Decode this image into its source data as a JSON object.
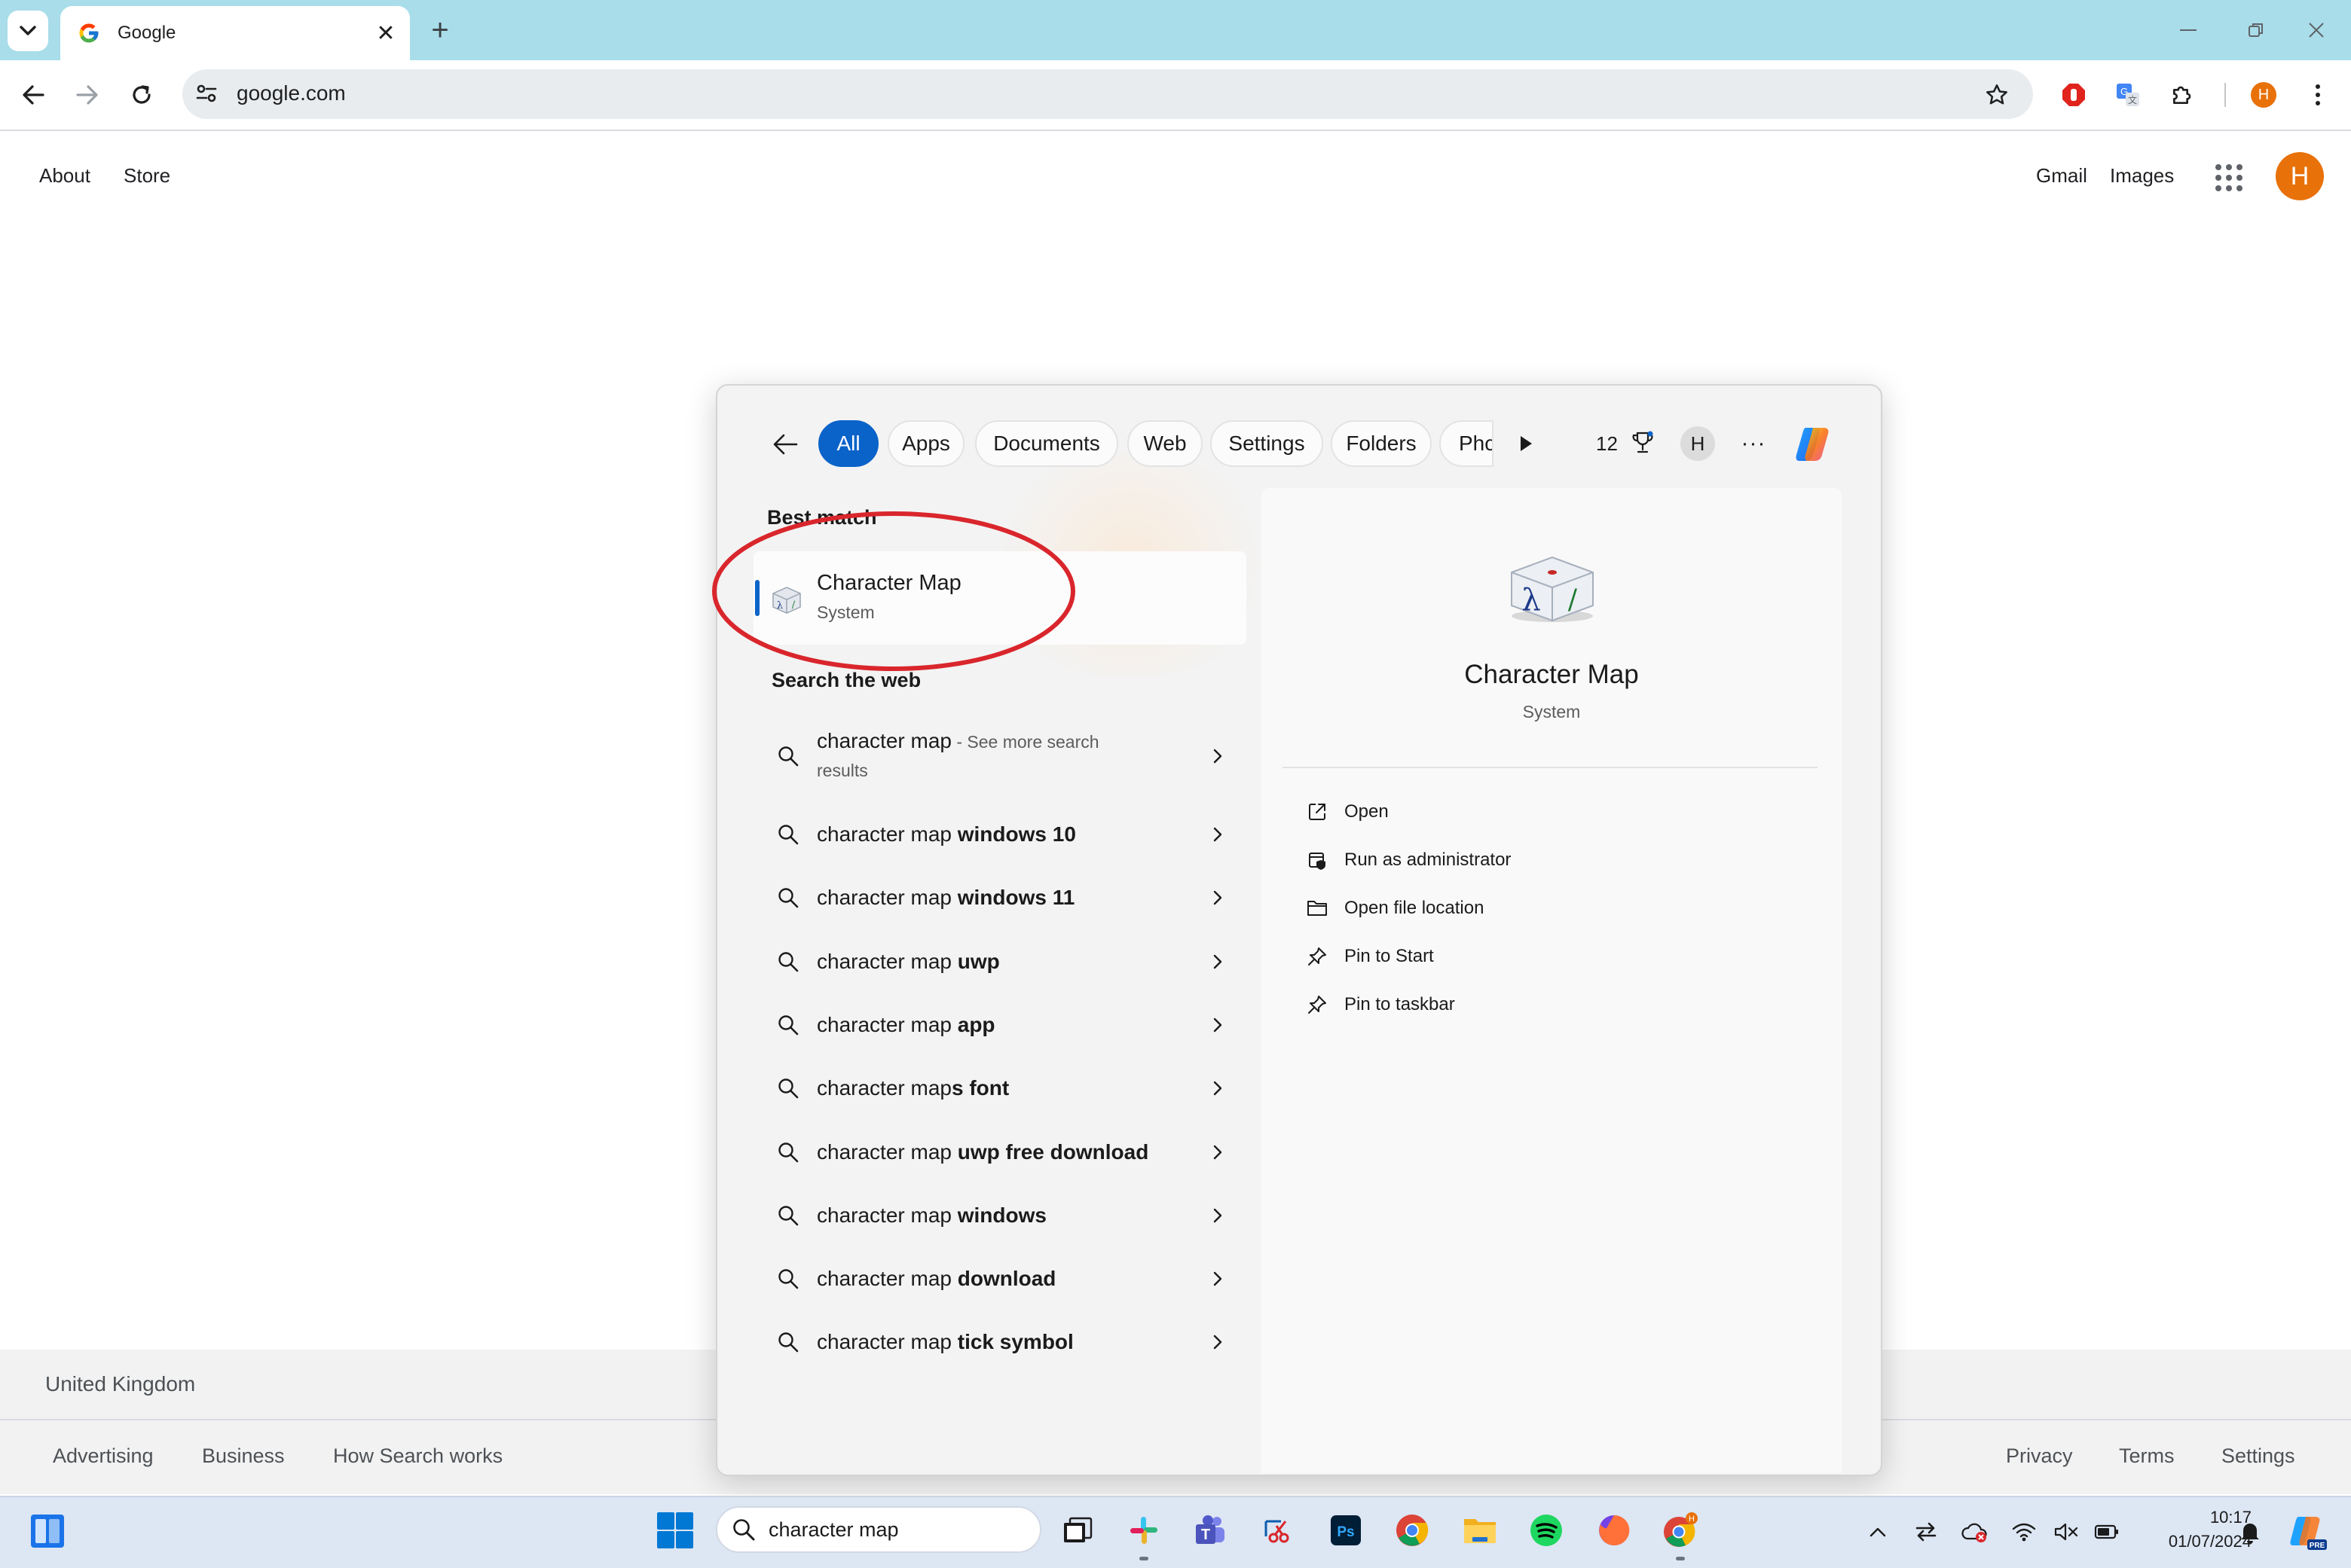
{
  "browser": {
    "tab": {
      "title": "Google",
      "close_glyph": "✕",
      "favicon": "google-g-icon"
    },
    "new_tab_glyph": "+",
    "window_controls": {
      "minimize": "—",
      "restore": "❐",
      "close": "✕"
    },
    "address_bar": {
      "url": "google.com"
    },
    "profile_letter": "H"
  },
  "google": {
    "top_left_links": [
      "About",
      "Store"
    ],
    "top_right_links": [
      "Gmail",
      "Images"
    ],
    "avatar_letter": "H",
    "footer": {
      "country": "United Kingdom",
      "left_links": [
        "Advertising",
        "Business",
        "How Search works"
      ],
      "right_links": [
        "Privacy",
        "Terms",
        "Settings"
      ]
    }
  },
  "search_flyout": {
    "filter_chips": [
      "All",
      "Apps",
      "Documents",
      "Web",
      "Settings",
      "Folders",
      "Phc"
    ],
    "active_chip": "All",
    "rewards_points": "12",
    "avatar_letter": "H",
    "more_glyph": "···",
    "best_match": {
      "section_label": "Best match",
      "name": "Character Map",
      "type": "System"
    },
    "web_section_label": "Search the web",
    "web_results": [
      {
        "prefix": "character map",
        "bold": "",
        "suffix": " - See more search",
        "line2": "results"
      },
      {
        "prefix": "character map ",
        "bold": "windows 10",
        "suffix": "",
        "line2": ""
      },
      {
        "prefix": "character map ",
        "bold": "windows 11",
        "suffix": "",
        "line2": ""
      },
      {
        "prefix": "character map ",
        "bold": "uwp",
        "suffix": "",
        "line2": ""
      },
      {
        "prefix": "character map ",
        "bold": "app",
        "suffix": "",
        "line2": ""
      },
      {
        "prefix": "character map",
        "bold": "s font",
        "suffix": "",
        "line2": ""
      },
      {
        "prefix": "character map ",
        "bold": "uwp free download",
        "suffix": "",
        "line2": ""
      },
      {
        "prefix": "character map ",
        "bold": "windows",
        "suffix": "",
        "line2": ""
      },
      {
        "prefix": "character map ",
        "bold": "download",
        "suffix": "",
        "line2": ""
      },
      {
        "prefix": "character map ",
        "bold": "tick symbol",
        "suffix": "",
        "line2": ""
      }
    ],
    "details": {
      "name": "Character Map",
      "type": "System",
      "actions": [
        {
          "label": "Open",
          "icon": "open-external-icon"
        },
        {
          "label": "Run as administrator",
          "icon": "shield-admin-icon"
        },
        {
          "label": "Open file location",
          "icon": "folder-icon"
        },
        {
          "label": "Pin to Start",
          "icon": "pin-icon"
        },
        {
          "label": "Pin to taskbar",
          "icon": "pin-icon"
        }
      ]
    }
  },
  "taskbar": {
    "search_text": "character map",
    "clock_time": "10:17",
    "clock_date": "01/07/2024",
    "apps": [
      "task-view",
      "slack",
      "teams",
      "snipping-tool",
      "photoshop",
      "chrome",
      "file-explorer",
      "spotify",
      "firefox",
      "chrome-profile"
    ],
    "colors": {
      "start_blue": "#0078d4",
      "accent": "#0a63c9"
    }
  },
  "annotation": {
    "color": "#d9262c",
    "shape": "ellipse"
  }
}
